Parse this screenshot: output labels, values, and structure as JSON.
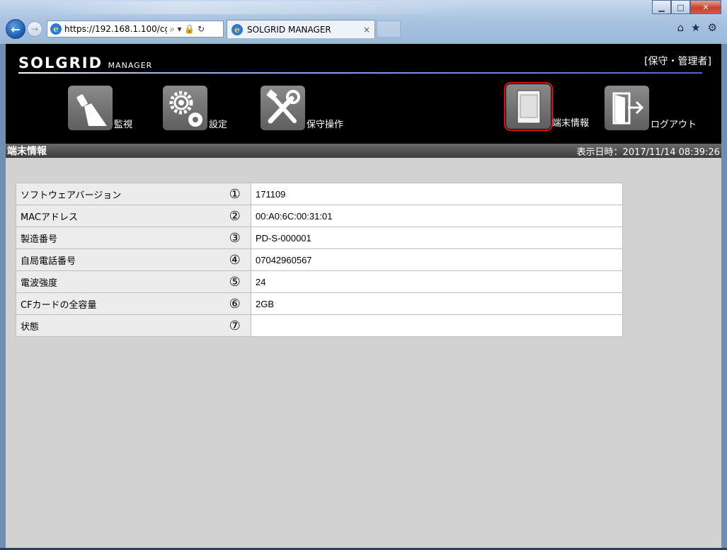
{
  "browser": {
    "url": "https://192.168.1.100/cgi-",
    "address_controls": "⌕ ▾ 🔒 ↻",
    "tab_title": "SOLGRID MANAGER",
    "tab_close": "×",
    "window_min": "▁",
    "window_max": "□",
    "window_close": "✕"
  },
  "header": {
    "logo_main": "SOLGRID",
    "logo_sub": "MANAGER",
    "role": "[保守・管理者]"
  },
  "menu": [
    {
      "label": "監視",
      "icon": "monitor-icon"
    },
    {
      "label": "設定",
      "icon": "gear-icon"
    },
    {
      "label": "保守操作",
      "icon": "tools-icon"
    },
    {
      "label": "端末情報",
      "icon": "device-icon",
      "active": true
    },
    {
      "label": "ログアウト",
      "icon": "logout-icon"
    }
  ],
  "subbar": {
    "title": "端末情報",
    "datetime": "表示日時：2017/11/14 08:39:26"
  },
  "rows": [
    {
      "label": "ソフトウェアバージョン",
      "num": "①",
      "value": "171109"
    },
    {
      "label": "MACアドレス",
      "num": "②",
      "value": "00:A0:6C:00:31:01"
    },
    {
      "label": "製造番号",
      "num": "③",
      "value": "PD-S-000001"
    },
    {
      "label": "自局電話番号",
      "num": "④",
      "value": "07042960567"
    },
    {
      "label": "電波強度",
      "num": "⑤",
      "value": "24"
    },
    {
      "label": "CFカードの全容量",
      "num": "⑥",
      "value": "2GB"
    },
    {
      "label": "状態",
      "num": "⑦",
      "value": ""
    }
  ],
  "colors": {
    "header_bg": "#000000",
    "page_bg": "#d2d2d2",
    "active_outline": "#e01010"
  }
}
